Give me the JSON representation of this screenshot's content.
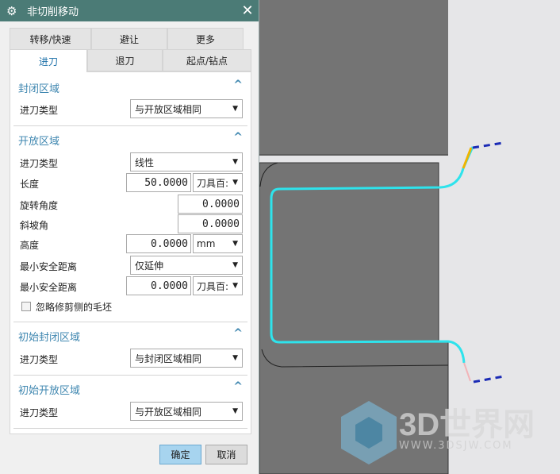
{
  "dialog": {
    "title": "非切削移动",
    "close": "✕",
    "gear": "⚙"
  },
  "tabs_row1": [
    "转移/快速",
    "避让",
    "更多"
  ],
  "tabs_row2": [
    "进刀",
    "退刀",
    "起点/钻点"
  ],
  "closed_area": {
    "title": "封闭区域",
    "type_label": "进刀类型",
    "type_value": "与开放区域相同"
  },
  "open_area": {
    "title": "开放区域",
    "type_label": "进刀类型",
    "type_value": "线性",
    "length_label": "长度",
    "length_value": "50.0000",
    "length_unit": "刀具百:",
    "rotation_label": "旋转角度",
    "rotation_value": "0.0000",
    "ramp_label": "斜坡角",
    "ramp_value": "0.0000",
    "height_label": "高度",
    "height_value": "0.0000",
    "height_unit": "mm",
    "min_clear_label": "最小安全距离",
    "min_clear_option": "仅延伸",
    "min_clear_label2": "最小安全距离",
    "min_clear_value": "0.0000",
    "min_clear_unit": "刀具百:",
    "ignore_label": "忽略修剪侧的毛坯",
    "ignore_checked": false
  },
  "initial_closed": {
    "title": "初始封闭区域",
    "type_label": "进刀类型",
    "type_value": "与封闭区域相同"
  },
  "initial_open": {
    "title": "初始开放区域",
    "type_label": "进刀类型",
    "type_value": "与开放区域相同"
  },
  "buttons": {
    "ok": "确定",
    "cancel": "取消"
  },
  "watermark": {
    "name": "3D世界网",
    "url": "WWW.3DSJW.COM"
  }
}
